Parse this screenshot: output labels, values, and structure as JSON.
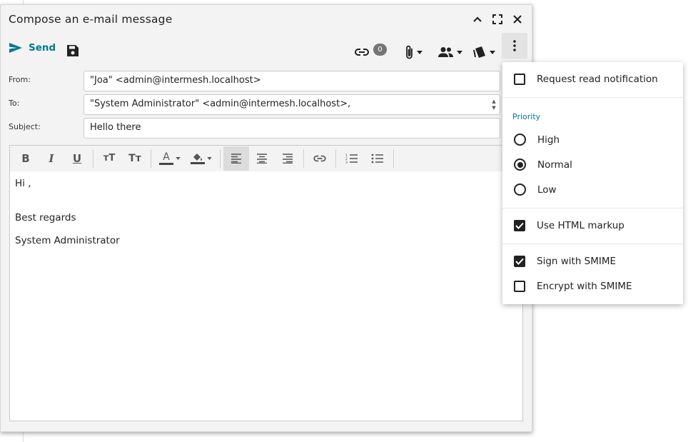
{
  "window": {
    "title": "Compose an e-mail message",
    "controls": [
      "collapse-icon",
      "maximize-icon",
      "close-icon"
    ]
  },
  "toolbar": {
    "send_label": "Send",
    "links_count": "0",
    "icons": [
      "send-icon",
      "save-icon",
      "link-icon",
      "attachment-icon",
      "contacts-icon",
      "template-icon",
      "more-vert-icon"
    ]
  },
  "form": {
    "from_label": "From:",
    "from_value": "\"Joa\" <admin@intermesh.localhost>",
    "to_label": "To:",
    "to_value": "\"System Administrator\" <admin@intermesh.localhost>,",
    "subject_label": "Subject:",
    "subject_value": "Hello there"
  },
  "editor": {
    "tools": [
      "bold-icon",
      "italic-icon",
      "underline-icon",
      "font-size-icon",
      "text-case-icon",
      "font-color-icon",
      "highlight-color-icon",
      "align-left-icon",
      "align-center-icon",
      "align-right-icon",
      "insert-link-icon",
      "numbered-list-icon",
      "bullet-list-icon"
    ],
    "body_lines": [
      "Hi ,",
      "",
      "Best regards",
      "",
      "System Administrator"
    ]
  },
  "menu": {
    "read_notification": {
      "label": "Request read notification",
      "checked": false
    },
    "priority_header": "Priority",
    "priority": [
      {
        "label": "High",
        "selected": false
      },
      {
        "label": "Normal",
        "selected": true
      },
      {
        "label": "Low",
        "selected": false
      }
    ],
    "html_markup": {
      "label": "Use HTML markup",
      "checked": true
    },
    "sign_smime": {
      "label": "Sign with SMIME",
      "checked": true
    },
    "encrypt_smime": {
      "label": "Encrypt with SMIME",
      "checked": false
    }
  },
  "colors": {
    "accent": "#00798a",
    "badge": "#757575"
  }
}
